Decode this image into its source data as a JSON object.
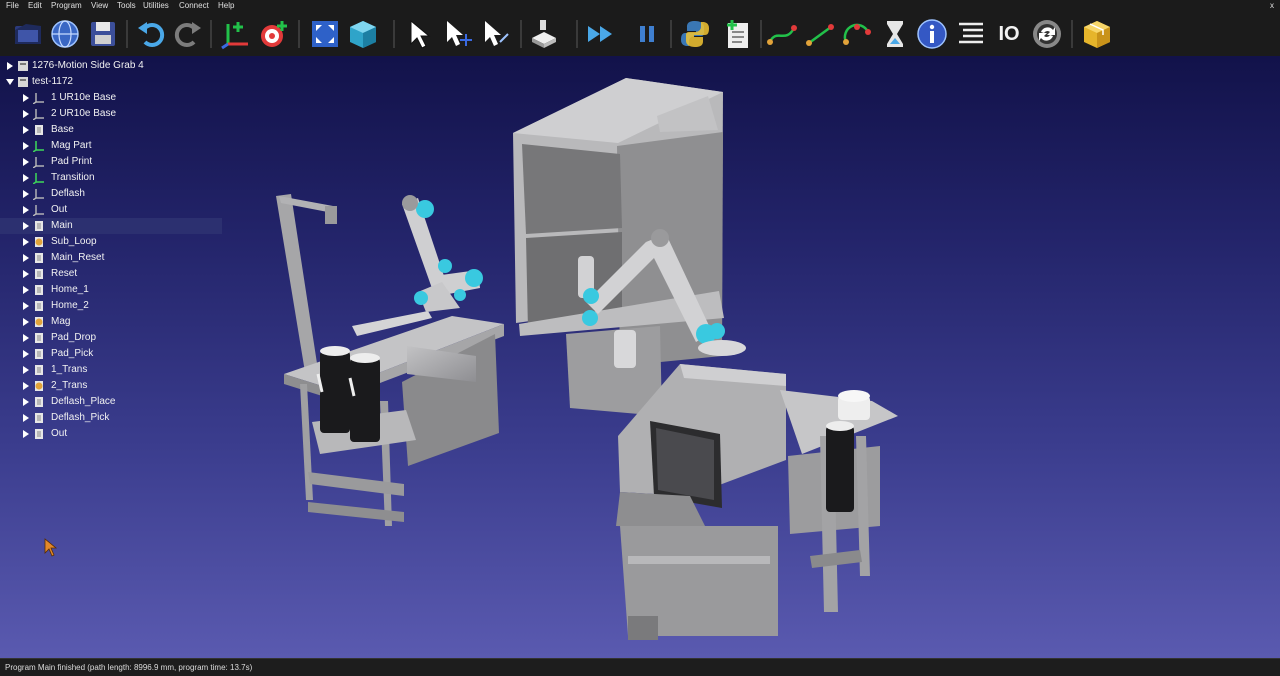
{
  "menu": [
    "File",
    "Edit",
    "Program",
    "View",
    "Tools",
    "Utilities",
    "Connect",
    "Help"
  ],
  "window": {
    "close_glyph": "x"
  },
  "toolbar": {
    "icons": [
      "open-station-icon",
      "web-icon",
      "save-icon",
      "undo-icon",
      "redo-icon",
      "add-frame-icon",
      "add-target-icon",
      "fit-all-icon",
      "view-cube-icon",
      "select-icon",
      "move-reference-icon",
      "move-object-icon",
      "teach-target-icon",
      "run-program-icon",
      "pause-icon",
      "python-script-icon",
      "new-program-icon",
      "move-joint-icon",
      "move-linear-icon",
      "move-circular-icon",
      "pause-instruction-icon",
      "info-icon",
      "program-instruction-icon",
      "io-icon",
      "call-program-icon",
      "package-icon"
    ],
    "io_label": "IO"
  },
  "tree": {
    "items": [
      {
        "label": "1276-Motion Side Grab 4",
        "level": 0,
        "expanded": false,
        "icon": "station-icon"
      },
      {
        "label": "test-1172",
        "level": 0,
        "expanded": true,
        "icon": "station-icon"
      },
      {
        "label": "1 UR10e Base",
        "level": 1,
        "expanded": false,
        "icon": "frame-icon"
      },
      {
        "label": "2 UR10e Base",
        "level": 1,
        "expanded": false,
        "icon": "frame-icon"
      },
      {
        "label": "Base",
        "level": 1,
        "expanded": false,
        "icon": "program-icon"
      },
      {
        "label": "Mag Part",
        "level": 1,
        "expanded": false,
        "icon": "frame-green-icon"
      },
      {
        "label": "Pad Print",
        "level": 1,
        "expanded": false,
        "icon": "frame-icon"
      },
      {
        "label": "Transition",
        "level": 1,
        "expanded": false,
        "icon": "frame-green-icon"
      },
      {
        "label": "Deflash",
        "level": 1,
        "expanded": false,
        "icon": "frame-icon"
      },
      {
        "label": "Out",
        "level": 1,
        "expanded": false,
        "icon": "frame-icon"
      },
      {
        "label": "Main",
        "level": 1,
        "expanded": false,
        "icon": "program-icon",
        "selected": true
      },
      {
        "label": "Sub_Loop",
        "level": 1,
        "expanded": false,
        "icon": "program-loop-icon"
      },
      {
        "label": "Main_Reset",
        "level": 1,
        "expanded": false,
        "icon": "program-icon"
      },
      {
        "label": "Reset",
        "level": 1,
        "expanded": false,
        "icon": "program-icon"
      },
      {
        "label": "Home_1",
        "level": 1,
        "expanded": false,
        "icon": "program-icon"
      },
      {
        "label": "Home_2",
        "level": 1,
        "expanded": false,
        "icon": "program-icon"
      },
      {
        "label": "Mag",
        "level": 1,
        "expanded": false,
        "icon": "program-loop-icon"
      },
      {
        "label": "Pad_Drop",
        "level": 1,
        "expanded": false,
        "icon": "program-icon"
      },
      {
        "label": "Pad_Pick",
        "level": 1,
        "expanded": false,
        "icon": "program-icon"
      },
      {
        "label": "1_Trans",
        "level": 1,
        "expanded": false,
        "icon": "program-icon"
      },
      {
        "label": "2_Trans",
        "level": 1,
        "expanded": false,
        "icon": "program-loop-icon"
      },
      {
        "label": "Deflash_Place",
        "level": 1,
        "expanded": false,
        "icon": "program-icon"
      },
      {
        "label": "Deflash_Pick",
        "level": 1,
        "expanded": false,
        "icon": "program-icon"
      },
      {
        "label": "Out",
        "level": 1,
        "expanded": false,
        "icon": "program-icon"
      }
    ]
  },
  "status": {
    "text": "Program Main finished (path length: 8996.9 mm, program time: 13.7s)"
  },
  "colors": {
    "viewport_top": "#12124a",
    "viewport_bottom": "#5a5ab0",
    "robot_joint": "#39c9e0",
    "machine_gray": "#a9a9ab"
  }
}
